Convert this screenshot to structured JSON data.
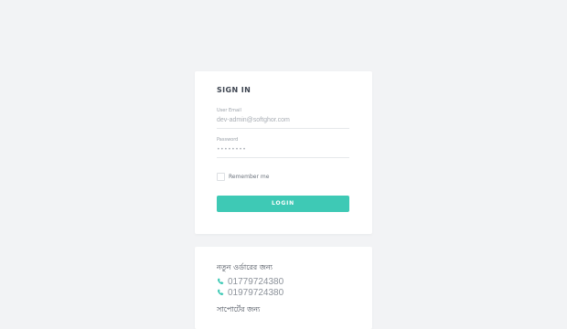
{
  "login": {
    "title": "SIGN IN",
    "email_label": "User Email",
    "email_value": "dev-admin@softghor.com",
    "password_label": "Password",
    "password_value": "••••••••",
    "remember_label": "Remember me",
    "remember_checked": false,
    "login_label": "LOGIN"
  },
  "contact": {
    "title": "নতুন ওর্ডারের জন্য",
    "phones": [
      "01779724380",
      "01979724380"
    ],
    "title_2": "সাপোর্টের জন্য"
  },
  "colors": {
    "accent": "#3ec9b5",
    "page_bg": "#f2f3f5",
    "card_bg": "#ffffff"
  },
  "icons": {
    "phone": "phone-icon"
  }
}
